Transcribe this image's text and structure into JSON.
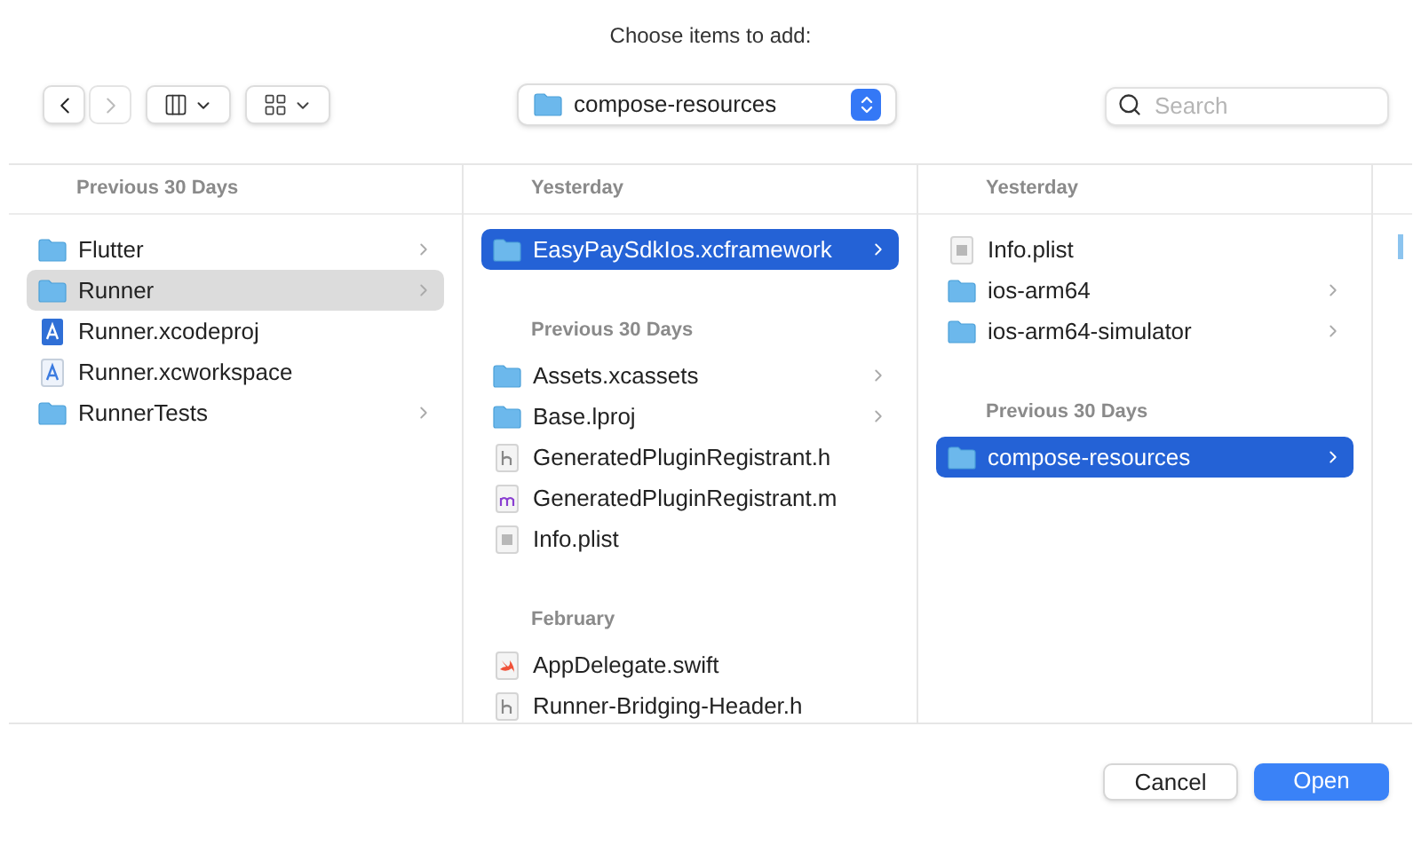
{
  "title": "Choose items to add:",
  "toolbar": {
    "location": "compose-resources",
    "search": {
      "placeholder": "Search"
    }
  },
  "columns": [
    {
      "focused": false,
      "sections": [
        {
          "heading": "Previous 30 Days",
          "items": [
            {
              "name": "Flutter",
              "kind": "folder",
              "expandable": true,
              "selected": false
            },
            {
              "name": "Runner",
              "kind": "folder",
              "expandable": true,
              "selected": true
            },
            {
              "name": "Runner.xcodeproj",
              "kind": "xcodeproj",
              "expandable": false,
              "selected": false
            },
            {
              "name": "Runner.xcworkspace",
              "kind": "xcworkspace",
              "expandable": false,
              "selected": false
            },
            {
              "name": "RunnerTests",
              "kind": "folder",
              "expandable": true,
              "selected": false
            }
          ]
        }
      ]
    },
    {
      "focused": true,
      "sections": [
        {
          "heading": "Yesterday",
          "items": [
            {
              "name": "EasyPaySdkIos.xcframework",
              "kind": "folder",
              "expandable": true,
              "selected": true
            }
          ]
        },
        {
          "heading": "Previous 30 Days",
          "items": [
            {
              "name": "Assets.xcassets",
              "kind": "folder",
              "expandable": true,
              "selected": false
            },
            {
              "name": "Base.lproj",
              "kind": "folder",
              "expandable": true,
              "selected": false
            },
            {
              "name": "GeneratedPluginRegistrant.h",
              "kind": "h",
              "expandable": false,
              "selected": false
            },
            {
              "name": "GeneratedPluginRegistrant.m",
              "kind": "m",
              "expandable": false,
              "selected": false
            },
            {
              "name": "Info.plist",
              "kind": "plist",
              "expandable": false,
              "selected": false
            }
          ]
        },
        {
          "heading": "February",
          "items": [
            {
              "name": "AppDelegate.swift",
              "kind": "swift",
              "expandable": false,
              "selected": false
            },
            {
              "name": "Runner-Bridging-Header.h",
              "kind": "h",
              "expandable": false,
              "selected": false
            }
          ]
        }
      ]
    },
    {
      "focused": true,
      "sections": [
        {
          "heading": "Yesterday",
          "items": [
            {
              "name": "Info.plist",
              "kind": "plist",
              "expandable": false,
              "selected": false
            },
            {
              "name": "ios-arm64",
              "kind": "folder",
              "expandable": true,
              "selected": false
            },
            {
              "name": "ios-arm64-simulator",
              "kind": "folder",
              "expandable": true,
              "selected": false
            }
          ]
        },
        {
          "heading": "Previous 30 Days",
          "items": [
            {
              "name": "compose-resources",
              "kind": "folder",
              "expandable": true,
              "selected": true
            }
          ]
        }
      ]
    }
  ],
  "buttons": [
    {
      "label": "Cancel",
      "kind": "secondary"
    },
    {
      "label": "Open",
      "kind": "primary"
    }
  ]
}
